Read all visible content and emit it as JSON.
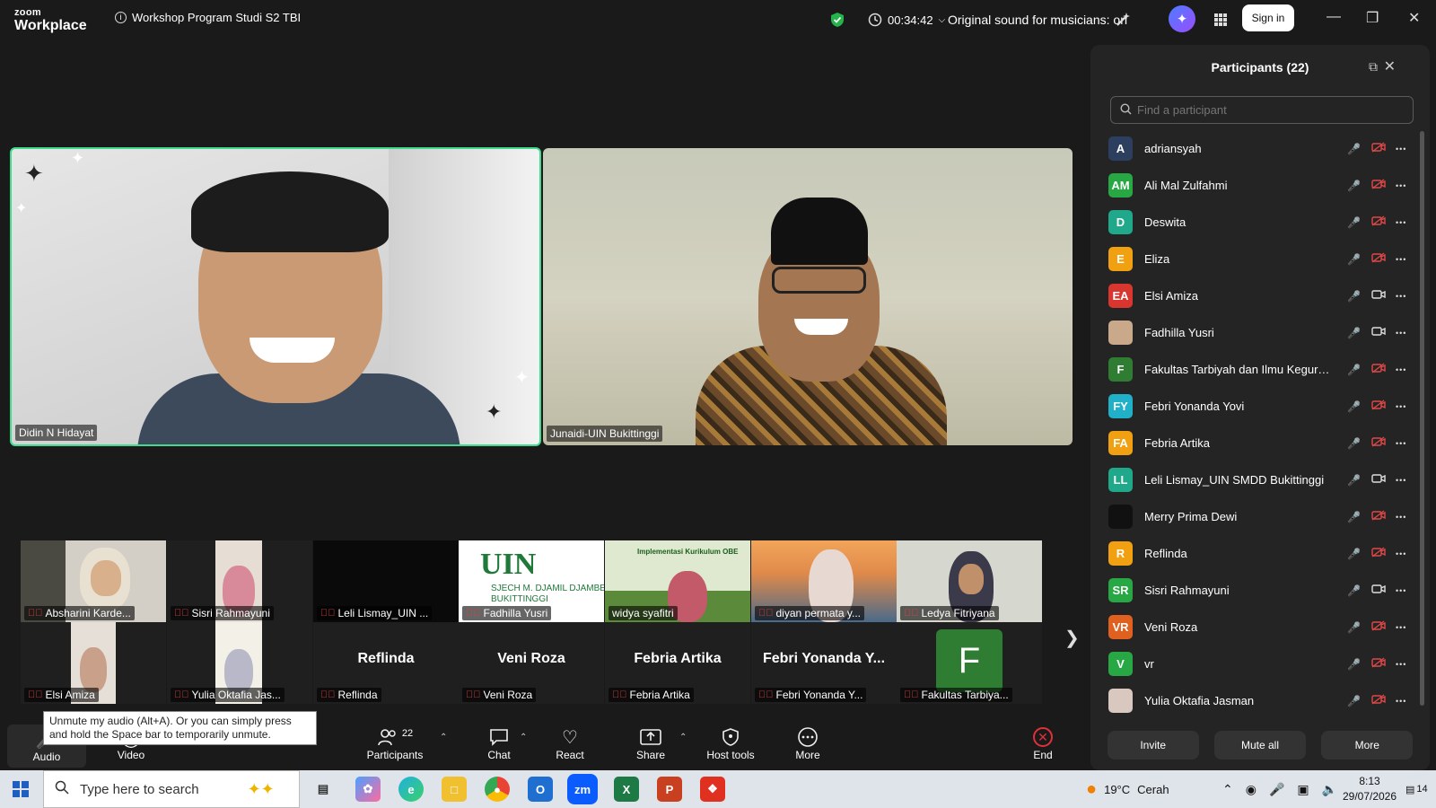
{
  "titlebar": {
    "brand_line1": "zoom",
    "brand_line2": "Workplace",
    "meeting_title": "Workshop Program Studi S2 TBI",
    "timer": "00:34:42",
    "sound_status": "Original sound for musicians: on",
    "signin_label": "Sign in"
  },
  "videos": {
    "speaker1_name": "Didin N Hidayat",
    "speaker2_name": "Junaidi-UIN Bukittinggi"
  },
  "thumbnails": [
    {
      "label": "Absharini Karde..."
    },
    {
      "label": "Sisri Rahmayuni"
    },
    {
      "label": "Leli Lismay_UIN ..."
    },
    {
      "label": "Fadhilla Yusri",
      "logo_text": "UIN",
      "logo_sub": "SJECH M. DJAMIL DJAMBE",
      "logo_sub2": "BUKITTINGGI"
    },
    {
      "label": "widya syafitri",
      "banner": "Implementasi Kurikulum OBE"
    },
    {
      "label": "diyan permata y..."
    },
    {
      "label": "Ledya Fitriyana"
    },
    {
      "label": "Elsi Amiza"
    },
    {
      "label": "Yulia Oktafia Jas..."
    },
    {
      "label": "Reflinda",
      "big": "Reflinda"
    },
    {
      "label": "Veni Roza",
      "big": "Veni Roza"
    },
    {
      "label": "Febria Artika",
      "big": "Febria Artika"
    },
    {
      "label": "Febri Yonanda Y...",
      "big": "Febri Yonanda Y..."
    },
    {
      "label": "Fakultas Tarbiya...",
      "avatar": "F"
    }
  ],
  "tooltip": "Unmute my audio (Alt+A). Or you can simply press and hold the Space bar to temporarily unmute.",
  "toolbar": {
    "audio": "Audio",
    "video": "Video",
    "participants": "Participants",
    "participants_count": "22",
    "chat": "Chat",
    "react": "React",
    "share": "Share",
    "host_tools": "Host tools",
    "more": "More",
    "end": "End"
  },
  "panel": {
    "title": "Participants (22)",
    "search_placeholder": "Find a participant",
    "participants": [
      {
        "initials": "A",
        "name": "adriansyah",
        "color": "#2d3f5e",
        "cam_on": false
      },
      {
        "initials": "AM",
        "name": "Ali Mal Zulfahmi",
        "color": "#27a844",
        "cam_on": false
      },
      {
        "initials": "D",
        "name": "Deswita",
        "color": "#1fa88a",
        "cam_on": false
      },
      {
        "initials": "E",
        "name": "Eliza",
        "color": "#f0a010",
        "cam_on": false
      },
      {
        "initials": "EA",
        "name": "Elsi Amiza",
        "color": "#d9362f",
        "cam_on": true
      },
      {
        "initials": "",
        "name": "Fadhilla Yusri",
        "color": "#c9a98a",
        "cam_on": true
      },
      {
        "initials": "F",
        "name": "Fakultas Tarbiyah dan Ilmu Keguru...",
        "color": "#2e7d32",
        "cam_on": false
      },
      {
        "initials": "FY",
        "name": "Febri Yonanda Yovi",
        "color": "#20b0c8",
        "cam_on": false
      },
      {
        "initials": "FA",
        "name": "Febria Artika",
        "color": "#f0a010",
        "cam_on": false
      },
      {
        "initials": "LL",
        "name": "Leli Lismay_UIN SMDD Bukittinggi",
        "color": "#1fa88a",
        "cam_on": true
      },
      {
        "initials": "",
        "name": "Merry Prima Dewi",
        "color": "#111111",
        "cam_on": false
      },
      {
        "initials": "R",
        "name": "Reflinda",
        "color": "#f0a010",
        "cam_on": false
      },
      {
        "initials": "SR",
        "name": "Sisri Rahmayuni",
        "color": "#27a844",
        "cam_on": true
      },
      {
        "initials": "VR",
        "name": "Veni Roza",
        "color": "#e06020",
        "cam_on": false
      },
      {
        "initials": "V",
        "name": "vr",
        "color": "#27a844",
        "cam_on": false
      },
      {
        "initials": "",
        "name": "Yulia Oktafia Jasman",
        "color": "#d8c8c0",
        "cam_on": false
      }
    ],
    "invite": "Invite",
    "mute_all": "Mute all",
    "more": "More"
  },
  "taskbar": {
    "search_placeholder": "Type here to search",
    "weather_temp": "19°C",
    "weather_desc": "Cerah",
    "time": "8:13",
    "date": "29/07/2026",
    "notifications": "14"
  }
}
